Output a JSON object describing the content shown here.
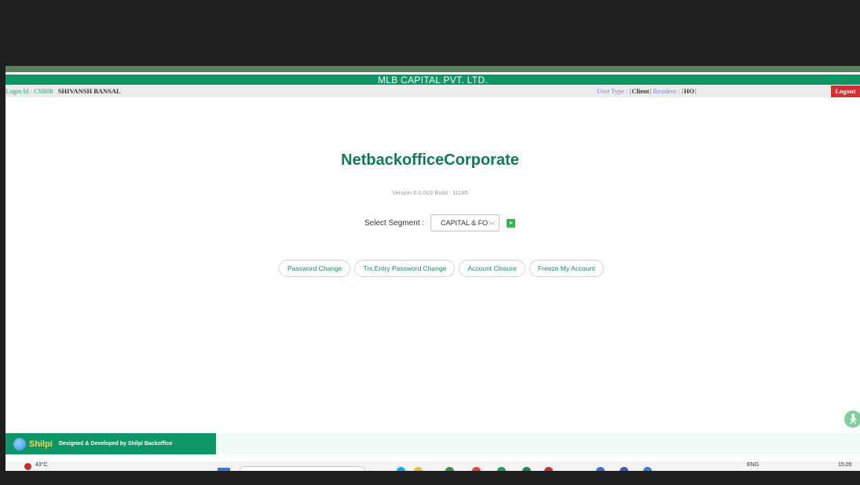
{
  "header": {
    "company_name": "MLB CAPITAL PVT. LTD.",
    "login_label": "Login Id : CSB08",
    "user_name": "SHIVANSH BANSAL",
    "user_type_label": "User Type : [",
    "user_type_value": "Client",
    "resident_label": "]  Resident : [",
    "resident_value": "HO",
    "resident_close": "]",
    "logout_label": "Logout"
  },
  "main": {
    "app_title": "NetbackofficeCorporate",
    "version_text": "Version 6.0.003 Build : 11165",
    "segment_label": "Select Segment :",
    "segment_selected": "CAPITAL & FO",
    "buttons": [
      {
        "label": "Password Change"
      },
      {
        "label": "Trx.Entry Password Change"
      },
      {
        "label": "Account Closure"
      },
      {
        "label": "Freeze My Account"
      }
    ]
  },
  "footer": {
    "logo_text": "Shilpi",
    "designed_text": "Designed & Developed by Shilpi Backoffice"
  },
  "taskbar": {
    "weather": "43°C",
    "language": "ENG",
    "time": "15:05"
  },
  "colors": {
    "brand_green": "#0e9664",
    "title_green": "#137a4f",
    "logout_red": "#d62f2f"
  },
  "icons": {
    "go": "play-triangle-icon",
    "accessibility": "accessibility-icon",
    "logo": "shilpi-globe-icon"
  }
}
